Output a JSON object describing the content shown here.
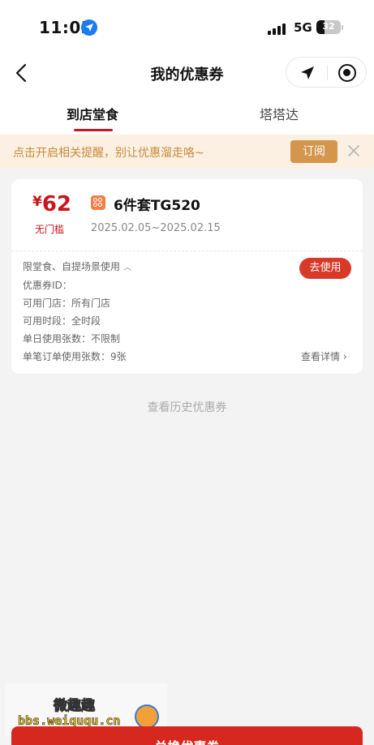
{
  "status_bar": {
    "time": "11:03",
    "network": "5G",
    "battery": "32",
    "battery_fraction": 0.32
  },
  "nav": {
    "title": "我的优惠券"
  },
  "tabs": [
    {
      "label": "到店堂食",
      "active": true
    },
    {
      "label": "塔塔达",
      "active": false
    }
  ],
  "notice": {
    "text": "点击开启相关提醒，别让优惠溜走咯~",
    "subscribe_label": "订阅"
  },
  "coupon": {
    "currency": "¥",
    "amount": "62",
    "threshold": "无门槛",
    "name": "6件套TG520",
    "validity": "2025.02.05~2025.02.15",
    "use_label": "去使用",
    "scope": "限堂食、自提场景使用",
    "details": [
      "优惠券ID：",
      "可用门店：所有门店",
      "可用时段：全时段",
      "单日使用张数：不限制",
      "单笔订单使用张数：9张"
    ],
    "view_details": "查看详情"
  },
  "history_link": "查看历史优惠券",
  "watermark": {
    "title": "微趣趣",
    "url": "bbs.weiququ.cn"
  },
  "bottom_button": "兑换优惠券",
  "colors": {
    "brand_red": "#c8161d",
    "notice_bg": "#fbf0e1",
    "subscribe_bg": "#d4954c",
    "use_button": "#d83a2a"
  }
}
